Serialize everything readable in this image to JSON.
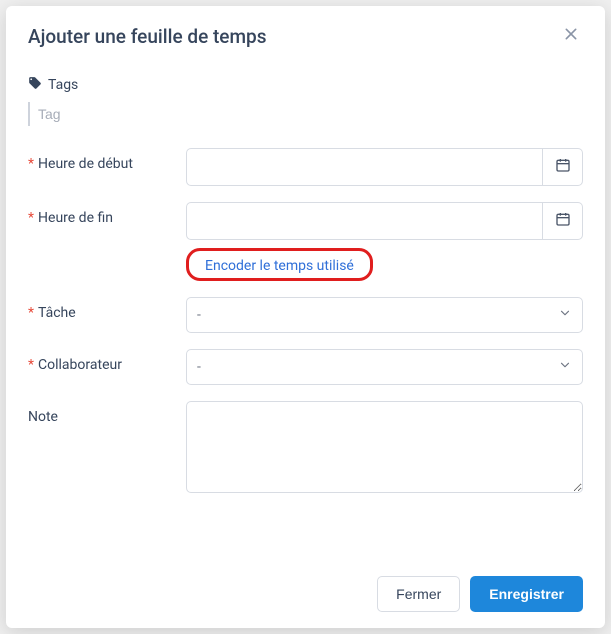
{
  "modal": {
    "title": "Ajouter une feuille de temps"
  },
  "tags": {
    "header": "Tags",
    "placeholder": "Tag"
  },
  "fields": {
    "start_time": {
      "label": "Heure de début",
      "value": ""
    },
    "end_time": {
      "label": "Heure de fin",
      "value": ""
    },
    "encode_link": "Encoder le temps utilisé",
    "task": {
      "label": "Tâche",
      "selected": "-"
    },
    "collaborator": {
      "label": "Collaborateur",
      "selected": "-"
    },
    "note": {
      "label": "Note",
      "value": ""
    }
  },
  "footer": {
    "close": "Fermer",
    "save": "Enregistrer"
  }
}
